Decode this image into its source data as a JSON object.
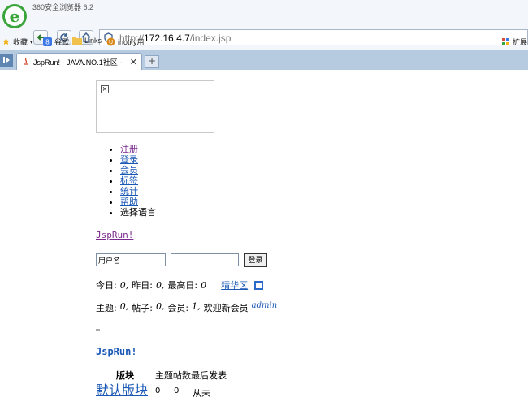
{
  "browser": {
    "app_title": "360安全浏览器 6.2",
    "url_scheme": "http://",
    "url_host": "172.16.4.7",
    "url_path": "/index.jsp",
    "bookmarks": [
      {
        "label": "收藏",
        "icon": "star-icon"
      },
      {
        "label": "谷歌",
        "icon": "google-icon"
      },
      {
        "label": "Links",
        "icon": "folder-icon"
      },
      {
        "label": "inotify用",
        "icon": "bookmark-icon"
      }
    ],
    "extend_label": "扩展",
    "tab_title": "JspRun! - JAVA.NO.1社区 - ",
    "new_tab": "+"
  },
  "page": {
    "menu": [
      {
        "label": "注册",
        "link": true,
        "visited": true
      },
      {
        "label": "登录",
        "link": true
      },
      {
        "label": "会员",
        "link": true
      },
      {
        "label": "标签",
        "link": true
      },
      {
        "label": "统计",
        "link": true
      },
      {
        "label": "帮助",
        "link": true
      },
      {
        "label": "选择语言",
        "link": false
      }
    ],
    "brand": "JspRun!",
    "login": {
      "username_value": "用户名",
      "password_value": "",
      "submit_label": "登录"
    },
    "stats1": {
      "today_label": "今日:",
      "today_value": "0,",
      "yesterday_label": "昨日:",
      "yesterday_value": "0,",
      "max_label": "最高日:",
      "max_value": "0",
      "digest_link": "精华区"
    },
    "stats2": {
      "topics_label": "主题:",
      "topics_value": "0,",
      "posts_label": "帖子:",
      "posts_value": "0,",
      "members_label": "会员:",
      "members_value": "1,",
      "welcome_label": "欢迎新会员",
      "new_member": "admin"
    },
    "brand2": "JspRun!",
    "forum_table": {
      "col_forum": "版块",
      "col_rest": "主题帖数最后发表",
      "rows": [
        {
          "name": "默认版块",
          "topics": "0",
          "posts": "0",
          "last": "从未"
        }
      ]
    }
  }
}
